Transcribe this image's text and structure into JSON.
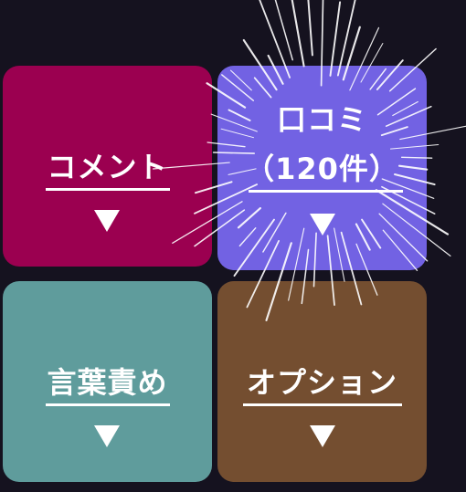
{
  "tiles": {
    "comment": {
      "label": "コメント",
      "bg": "#9b0050"
    },
    "reviews": {
      "label_line1": "口コミ",
      "label_line2": "（120件）",
      "bg": "#7262e3"
    },
    "words": {
      "label": "言葉責め",
      "bg": "#5f9c9c"
    },
    "options": {
      "label": "オプション",
      "bg": "#744e30"
    }
  },
  "icons": {
    "expand": "triangle-down-icon",
    "highlight": "sunburst-icon"
  },
  "colors": {
    "background": "#15121f",
    "text": "#ffffff",
    "burst": "#ffffff"
  }
}
